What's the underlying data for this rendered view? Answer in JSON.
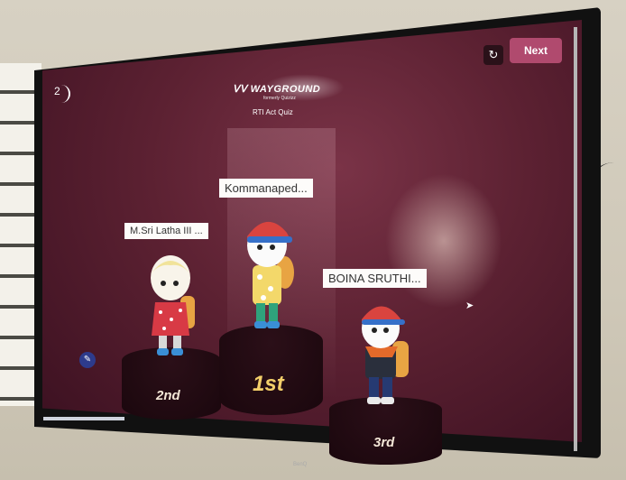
{
  "header": {
    "logo_text": "WAYGROUND",
    "logo_subtext": "formerly Quizizz",
    "quiz_title": "RTI Act Quiz",
    "question_number": "2"
  },
  "controls": {
    "reset_icon": "refresh-icon",
    "next_label": "Next"
  },
  "podium": [
    {
      "place": "1st",
      "name": "Kommanaped..."
    },
    {
      "place": "2nd",
      "name": "M.Sri Latha III ..."
    },
    {
      "place": "3rd",
      "name": "BOINA SRUTHI..."
    }
  ],
  "tv_brand": "BenQ",
  "colors": {
    "background": "#5c2132",
    "next_button": "#b04a6e",
    "first_place": "#f3cf6a"
  }
}
